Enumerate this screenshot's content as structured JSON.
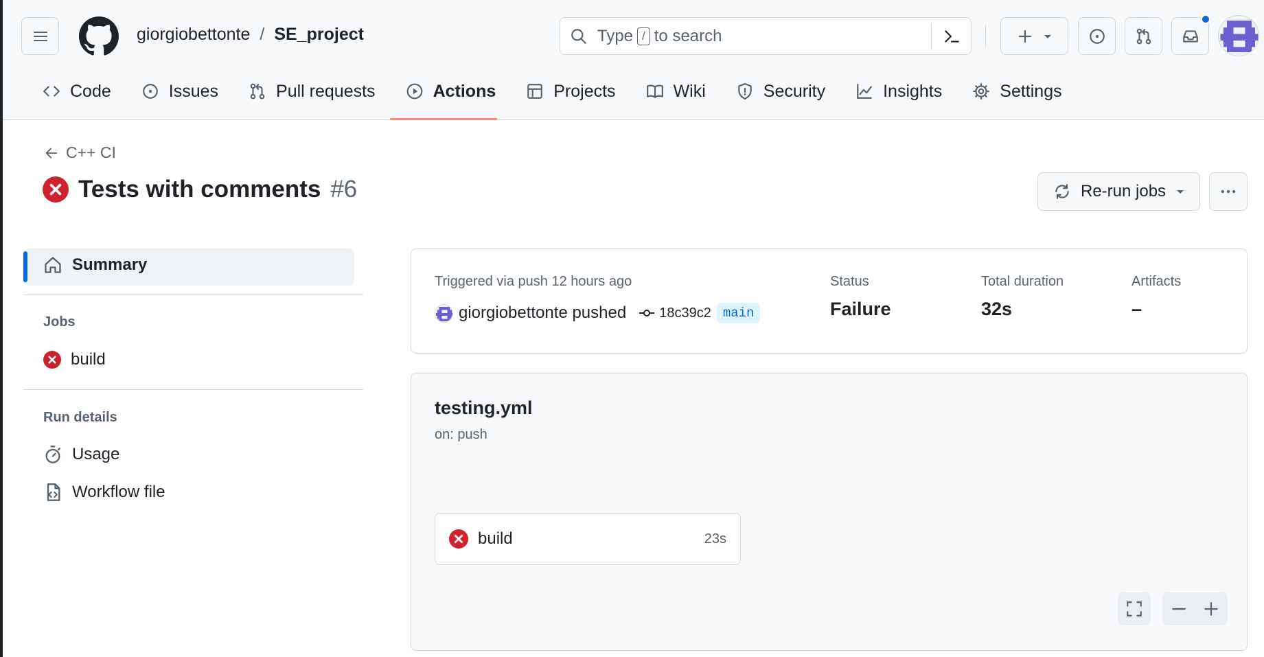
{
  "header": {
    "owner": "giorgiobettonte",
    "separator": "/",
    "repo": "SE_project",
    "search": {
      "prefix": "Type",
      "key": "/",
      "suffix": "to search"
    }
  },
  "nav": {
    "items": [
      {
        "label": "Code",
        "icon": "code-icon"
      },
      {
        "label": "Issues",
        "icon": "issue-opened-icon"
      },
      {
        "label": "Pull requests",
        "icon": "git-pull-request-icon"
      },
      {
        "label": "Actions",
        "icon": "play-icon",
        "active": true
      },
      {
        "label": "Projects",
        "icon": "table-icon"
      },
      {
        "label": "Wiki",
        "icon": "book-icon"
      },
      {
        "label": "Security",
        "icon": "shield-icon"
      },
      {
        "label": "Insights",
        "icon": "graph-icon"
      },
      {
        "label": "Settings",
        "icon": "gear-icon"
      }
    ]
  },
  "run": {
    "back_label": "C++ CI",
    "title": "Tests with comments",
    "number": "#6",
    "rerun_label": "Re-run jobs"
  },
  "sidebar": {
    "summary": "Summary",
    "jobs_heading": "Jobs",
    "jobs": [
      {
        "label": "build",
        "status": "failure"
      }
    ],
    "details_heading": "Run details",
    "details": [
      {
        "label": "Usage"
      },
      {
        "label": "Workflow file"
      }
    ]
  },
  "summary": {
    "trigger": "Triggered via push 12 hours ago",
    "actor": "giorgiobettonte pushed",
    "sha": "18c39c2",
    "branch": "main",
    "status_label": "Status",
    "status_value": "Failure",
    "duration_label": "Total duration",
    "duration_value": "32s",
    "artifacts_label": "Artifacts",
    "artifacts_value": "–"
  },
  "workflow": {
    "file": "testing.yml",
    "on": "on: push",
    "job": {
      "label": "build",
      "duration": "23s",
      "status": "failure"
    }
  },
  "colors": {
    "accent": "#0969da",
    "failure": "#cf222e",
    "nav_underline": "#fd8c73"
  }
}
